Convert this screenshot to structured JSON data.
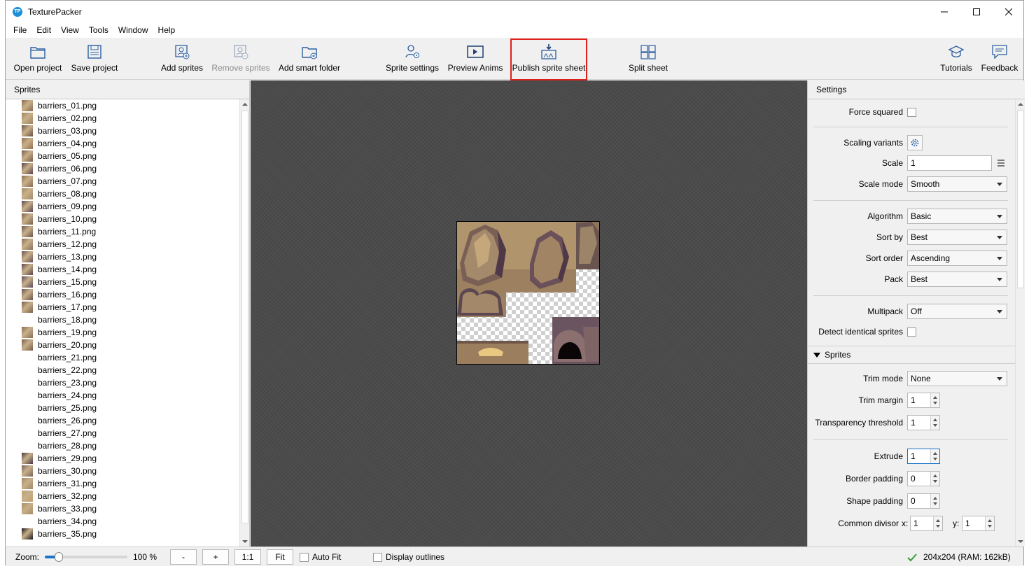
{
  "window": {
    "title": "TexturePacker",
    "app_icon_text": "TP"
  },
  "menu": [
    "File",
    "Edit",
    "View",
    "Tools",
    "Window",
    "Help"
  ],
  "toolbar": {
    "open_project": "Open project",
    "save_project": "Save project",
    "add_sprites": "Add sprites",
    "remove_sprites": "Remove sprites",
    "add_smart_folder": "Add smart folder",
    "sprite_settings": "Sprite settings",
    "preview_anims": "Preview Anims",
    "publish_sprite_sheet": "Publish sprite sheet",
    "split_sheet": "Split sheet",
    "tutorials": "Tutorials",
    "feedback": "Feedback"
  },
  "sprites_panel": {
    "title": "Sprites",
    "items": [
      {
        "name": "barriers_01.png",
        "thumb": "#8a6a4a"
      },
      {
        "name": "barriers_02.png",
        "thumb": "#a0845c"
      },
      {
        "name": "barriers_03.png",
        "thumb": "#6a5044"
      },
      {
        "name": "barriers_04.png",
        "thumb": "#94704c"
      },
      {
        "name": "barriers_05.png",
        "thumb": "#7a5a48"
      },
      {
        "name": "barriers_06.png",
        "thumb": "#5a4048"
      },
      {
        "name": "barriers_07.png",
        "thumb": "#8c6c50"
      },
      {
        "name": "barriers_08.png",
        "thumb": "#a48c68"
      },
      {
        "name": "barriers_09.png",
        "thumb": "#5c4450"
      },
      {
        "name": "barriers_10.png",
        "thumb": "#7c6048"
      },
      {
        "name": "barriers_11.png",
        "thumb": "#6c5448"
      },
      {
        "name": "barriers_12.png",
        "thumb": "#8a7058"
      },
      {
        "name": "barriers_13.png",
        "thumb": "#6a5050"
      },
      {
        "name": "barriers_14.png",
        "thumb": "#5c4448"
      },
      {
        "name": "barriers_15.png",
        "thumb": "#604858"
      },
      {
        "name": "barriers_16.png",
        "thumb": "#6a5050"
      },
      {
        "name": "barriers_17.png",
        "thumb": "#7a6048"
      },
      {
        "name": "barriers_18.png",
        "thumb": ""
      },
      {
        "name": "barriers_19.png",
        "thumb": "#8a6c54"
      },
      {
        "name": "barriers_20.png",
        "thumb": "#7a5c48"
      },
      {
        "name": "barriers_21.png",
        "thumb": ""
      },
      {
        "name": "barriers_22.png",
        "thumb": ""
      },
      {
        "name": "barriers_23.png",
        "thumb": ""
      },
      {
        "name": "barriers_24.png",
        "thumb": ""
      },
      {
        "name": "barriers_25.png",
        "thumb": ""
      },
      {
        "name": "barriers_26.png",
        "thumb": ""
      },
      {
        "name": "barriers_27.png",
        "thumb": ""
      },
      {
        "name": "barriers_28.png",
        "thumb": ""
      },
      {
        "name": "barriers_29.png",
        "thumb": "#4a3840"
      },
      {
        "name": "barriers_30.png",
        "thumb": "#7a6458"
      },
      {
        "name": "barriers_31.png",
        "thumb": "#a08868"
      },
      {
        "name": "barriers_32.png",
        "thumb": "#c0a070"
      },
      {
        "name": "barriers_33.png",
        "thumb": "#a88c64"
      },
      {
        "name": "barriers_34.png",
        "thumb": ""
      },
      {
        "name": "barriers_35.png",
        "thumb": "#1a1418"
      }
    ]
  },
  "settings": {
    "title": "Settings",
    "force_squared_label": "Force squared",
    "scaling_variants_label": "Scaling variants",
    "scale_label": "Scale",
    "scale_value": "1",
    "scale_mode_label": "Scale mode",
    "scale_mode_value": "Smooth",
    "algorithm_label": "Algorithm",
    "algorithm_value": "Basic",
    "sort_by_label": "Sort by",
    "sort_by_value": "Best",
    "sort_order_label": "Sort order",
    "sort_order_value": "Ascending",
    "pack_label": "Pack",
    "pack_value": "Best",
    "multipack_label": "Multipack",
    "multipack_value": "Off",
    "detect_identical_label": "Detect identical sprites",
    "sprites_section": "Sprites",
    "trim_mode_label": "Trim mode",
    "trim_mode_value": "None",
    "trim_margin_label": "Trim margin",
    "trim_margin_value": "1",
    "transparency_threshold_label": "Transparency threshold",
    "transparency_threshold_value": "1",
    "extrude_label": "Extrude",
    "extrude_value": "1",
    "border_padding_label": "Border padding",
    "border_padding_value": "0",
    "shape_padding_label": "Shape padding",
    "shape_padding_value": "0",
    "common_divisor_label": "Common divisor",
    "common_divisor_x_label": "x:",
    "common_divisor_x_value": "1",
    "common_divisor_y_label": "y:",
    "common_divisor_y_value": "1"
  },
  "statusbar": {
    "zoom_label": "Zoom:",
    "zoom_value": "100 %",
    "zoom_level": 0.17,
    "minus": "-",
    "plus": "+",
    "one_to_one": "1:1",
    "fit": "Fit",
    "auto_fit": "Auto Fit",
    "display_outlines": "Display outlines",
    "sheet_info": "204x204 (RAM: 162kB)"
  },
  "colors": {
    "accent": "#1a8fd8",
    "highlight": "#e0201c",
    "ok_green": "#3a9a3a"
  }
}
